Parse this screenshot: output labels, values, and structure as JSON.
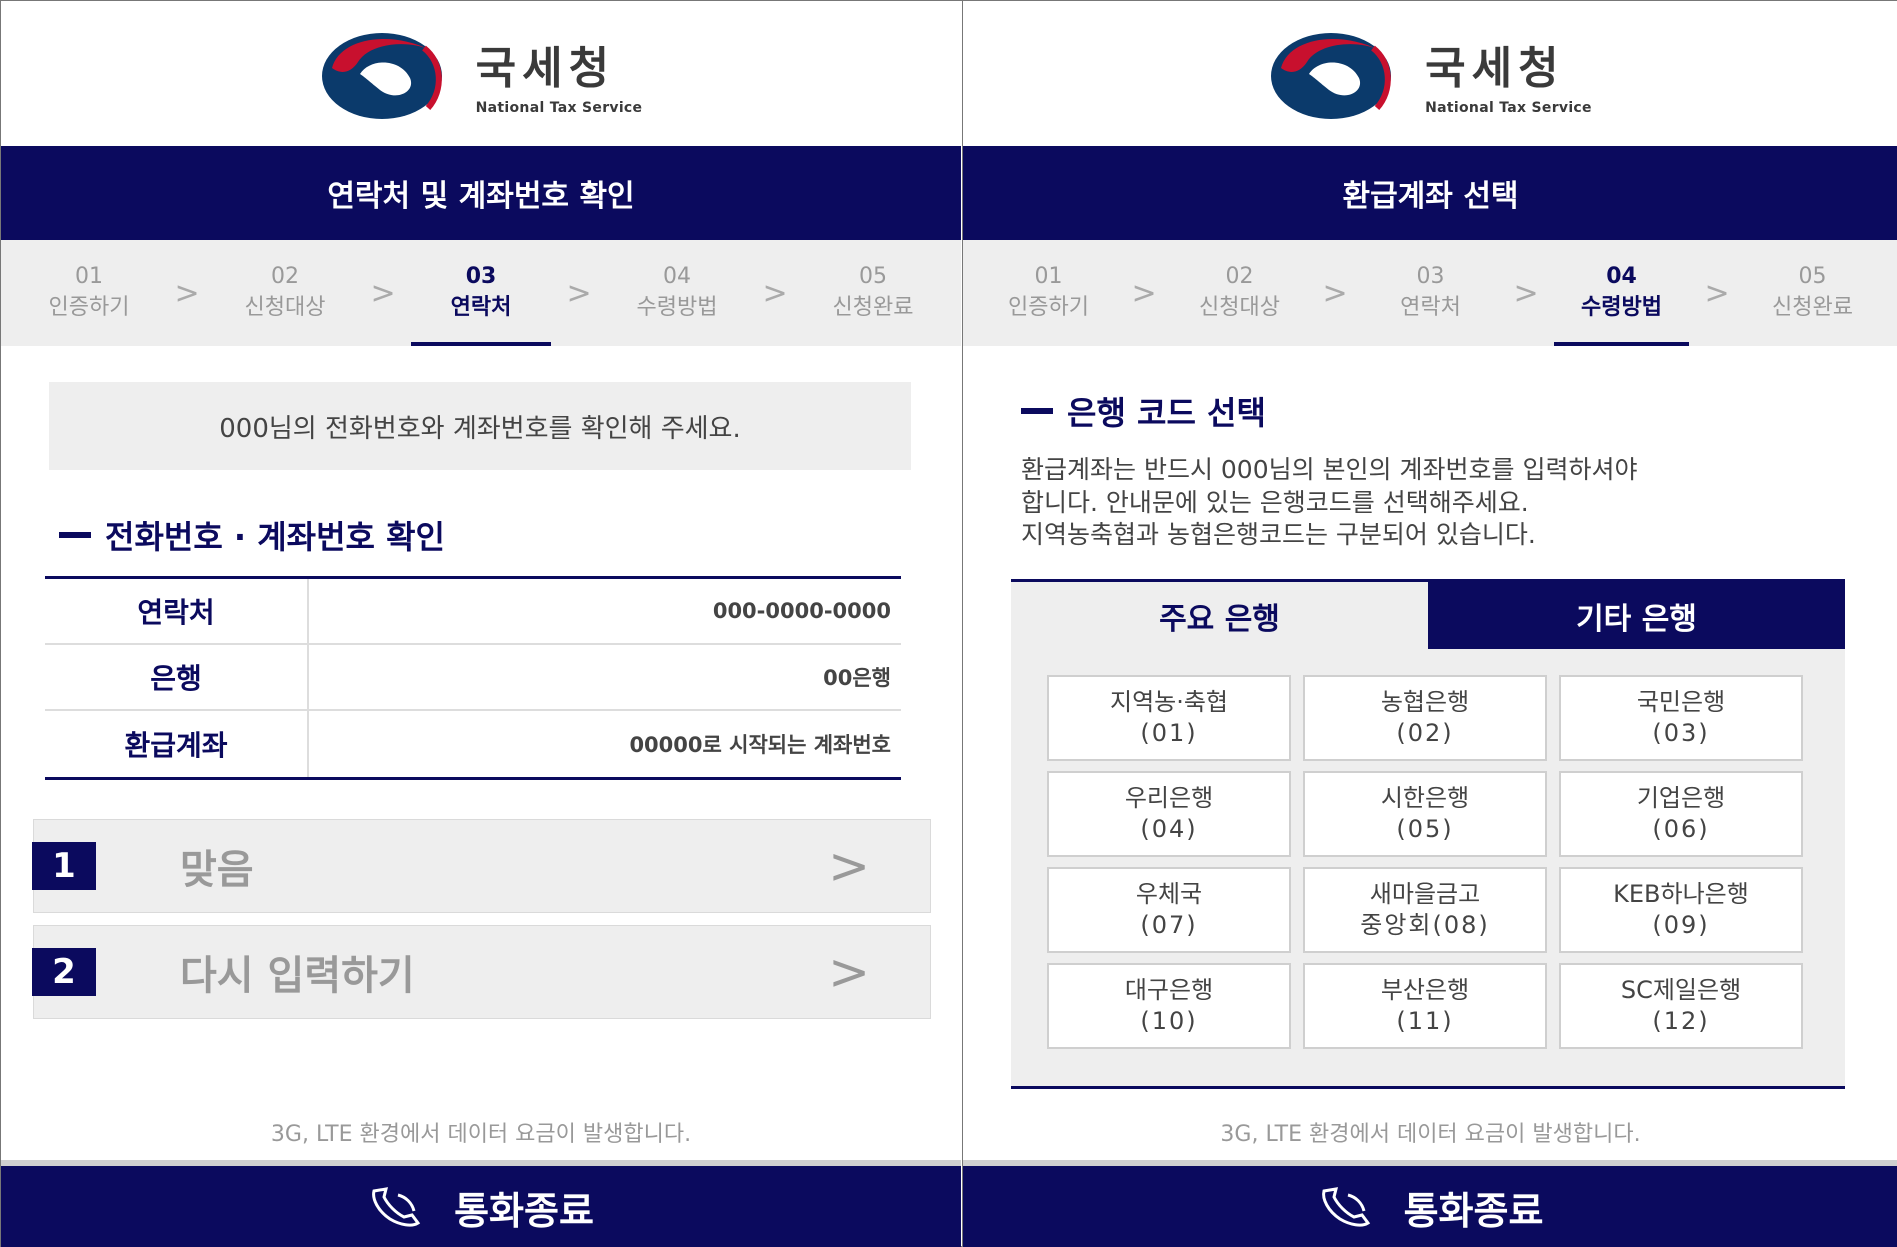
{
  "brand": {
    "kor": "국세청",
    "eng": "National Tax Service"
  },
  "left": {
    "title": "연락처 및 계좌번호 확인",
    "steps": [
      {
        "num": "01",
        "label": "인증하기"
      },
      {
        "num": "02",
        "label": "신청대상"
      },
      {
        "num": "03",
        "label": "연락처"
      },
      {
        "num": "04",
        "label": "수령방법"
      },
      {
        "num": "05",
        "label": "신청완료"
      }
    ],
    "active_step": 2,
    "notice": "000님의 전화번호와 계좌번호를 확인해 주세요.",
    "section_title": "전화번호 · 계좌번호 확인",
    "rows": [
      {
        "label": "연락처",
        "value": "000-0000-0000"
      },
      {
        "label": "은행",
        "value": "00은행"
      },
      {
        "label": "환급계좌",
        "value": "00000로 시작되는 계좌번호"
      }
    ],
    "options": [
      {
        "num": "1",
        "label": "맞음",
        "arrow": ">"
      },
      {
        "num": "2",
        "label": "다시 입력하기",
        "arrow": ">"
      }
    ],
    "footer_note": "3G, LTE 환경에서 데이터 요금이 발생합니다.",
    "end_call": "통화종료"
  },
  "right": {
    "title": "환급계좌 선택",
    "steps": [
      {
        "num": "01",
        "label": "인증하기"
      },
      {
        "num": "02",
        "label": "신청대상"
      },
      {
        "num": "03",
        "label": "연락처"
      },
      {
        "num": "04",
        "label": "수령방법"
      },
      {
        "num": "05",
        "label": "신청완료"
      }
    ],
    "active_step": 3,
    "section_title": "은행 코드 선택",
    "desc_lines": [
      "환급계좌는 반드시 000님의 본인의 계좌번호를 입력하셔야",
      "합니다. 안내문에 있는 은행코드를 선택해주세요.",
      "지역농축협과 농협은행코드는 구분되어 있습니다."
    ],
    "tabs": [
      "주요 은행",
      "기타 은행"
    ],
    "banks": [
      {
        "name": "지역농·축협",
        "code": "(01)"
      },
      {
        "name": "농협은행",
        "code": "(02)"
      },
      {
        "name": "국민은행",
        "code": "(03)"
      },
      {
        "name": "우리은행",
        "code": "(04)"
      },
      {
        "name": "시한은행",
        "code": "(05)"
      },
      {
        "name": "기업은행",
        "code": "(06)"
      },
      {
        "name": "우체국",
        "code": "(07)"
      },
      {
        "name": "새마을금고",
        "code": "중앙회(08)"
      },
      {
        "name": "KEB하나은행",
        "code": "(09)"
      },
      {
        "name": "대구은행",
        "code": "(10)"
      },
      {
        "name": "부산은행",
        "code": "(11)"
      },
      {
        "name": "SC제일은행",
        "code": "(12)"
      }
    ],
    "footer_note": "3G, LTE 환경에서 데이터 요금이 발생합니다.",
    "end_call": "통화종료"
  },
  "colors": {
    "navy": "#0b0a5e",
    "red": "#c8102e",
    "grey": "#eeeeee"
  }
}
